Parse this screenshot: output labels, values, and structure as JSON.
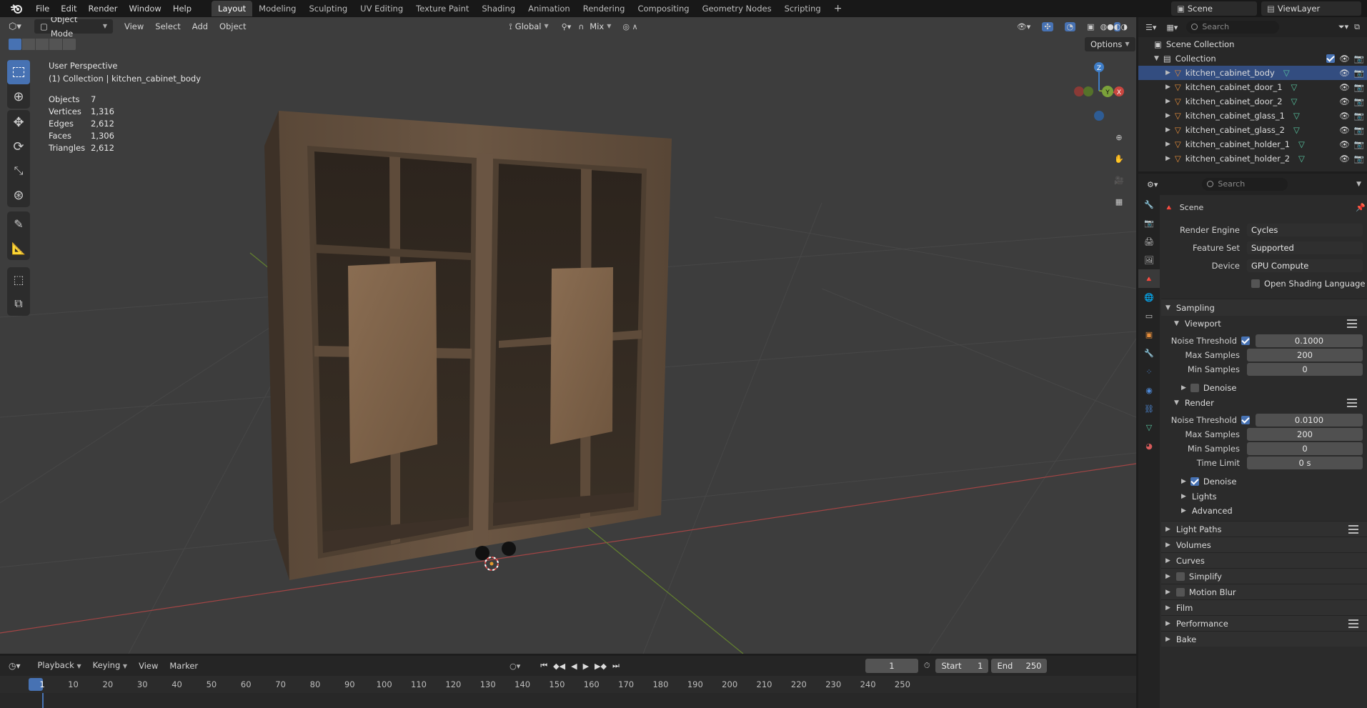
{
  "menubar": {
    "items": [
      "File",
      "Edit",
      "Render",
      "Window",
      "Help"
    ],
    "workspaces": [
      "Layout",
      "Modeling",
      "Sculpting",
      "UV Editing",
      "Texture Paint",
      "Shading",
      "Animation",
      "Rendering",
      "Compositing",
      "Geometry Nodes",
      "Scripting"
    ],
    "active_workspace": "Layout",
    "add_tab": "+",
    "scene_name": "Scene",
    "view_layer": "ViewLayer"
  },
  "viewport": {
    "mode": "Object Mode",
    "menus": [
      "View",
      "Select",
      "Add",
      "Object"
    ],
    "orientation": "Global",
    "pivot_mix": "Mix",
    "options_label": "Options",
    "perspective": "User Perspective",
    "collection_line": "(1) Collection | kitchen_cabinet_body",
    "stats": [
      {
        "label": "Objects",
        "value": "7"
      },
      {
        "label": "Vertices",
        "value": "1,316"
      },
      {
        "label": "Edges",
        "value": "2,612"
      },
      {
        "label": "Faces",
        "value": "1,306"
      },
      {
        "label": "Triangles",
        "value": "2,612"
      }
    ],
    "gizmo_axes": {
      "z": "Z",
      "y": "Y",
      "x": "X"
    }
  },
  "timeline": {
    "menus": [
      "Playback",
      "Keying",
      "View",
      "Marker"
    ],
    "current_frame": "1",
    "start_label": "Start",
    "start_value": "1",
    "end_label": "End",
    "end_value": "250",
    "ruler_ticks": [
      "1",
      "10",
      "20",
      "30",
      "40",
      "50",
      "60",
      "70",
      "80",
      "90",
      "100",
      "110",
      "120",
      "130",
      "140",
      "150",
      "160",
      "170",
      "180",
      "190",
      "200",
      "210",
      "220",
      "230",
      "240",
      "250"
    ]
  },
  "outliner": {
    "search_placeholder": "Search",
    "scene_collection": "Scene Collection",
    "collection": "Collection",
    "objects": [
      "kitchen_cabinet_body",
      "kitchen_cabinet_door_1",
      "kitchen_cabinet_door_2",
      "kitchen_cabinet_glass_1",
      "kitchen_cabinet_glass_2",
      "kitchen_cabinet_holder_1",
      "kitchen_cabinet_holder_2"
    ]
  },
  "properties": {
    "search_placeholder": "Search",
    "context": "Scene",
    "render_engine_label": "Render Engine",
    "render_engine": "Cycles",
    "feature_set_label": "Feature Set",
    "feature_set": "Supported",
    "device_label": "Device",
    "device": "GPU Compute",
    "osl_label": "Open Shading Language",
    "sampling": "Sampling",
    "viewport_label": "Viewport",
    "render_label": "Render",
    "noise_threshold_label": "Noise Threshold",
    "viewport_noise_threshold": "0.1000",
    "max_samples_label": "Max Samples",
    "viewport_max_samples": "200",
    "min_samples_label": "Min Samples",
    "viewport_min_samples": "0",
    "denoise_label": "Denoise",
    "render_noise_threshold": "0.0100",
    "render_max_samples": "200",
    "render_min_samples": "0",
    "time_limit_label": "Time Limit",
    "time_limit": "0 s",
    "lights": "Lights",
    "advanced": "Advanced",
    "panels": [
      "Light Paths",
      "Volumes",
      "Curves",
      "Simplify",
      "Motion Blur",
      "Film",
      "Performance",
      "Bake"
    ]
  },
  "colors": {
    "accent": "#4772b3",
    "x_axis": "#c9463f",
    "y_axis": "#7ba23a",
    "z_axis": "#3e7dc7",
    "object_icon": "#e38c3a",
    "mesh_icon": "#58c4a0"
  }
}
